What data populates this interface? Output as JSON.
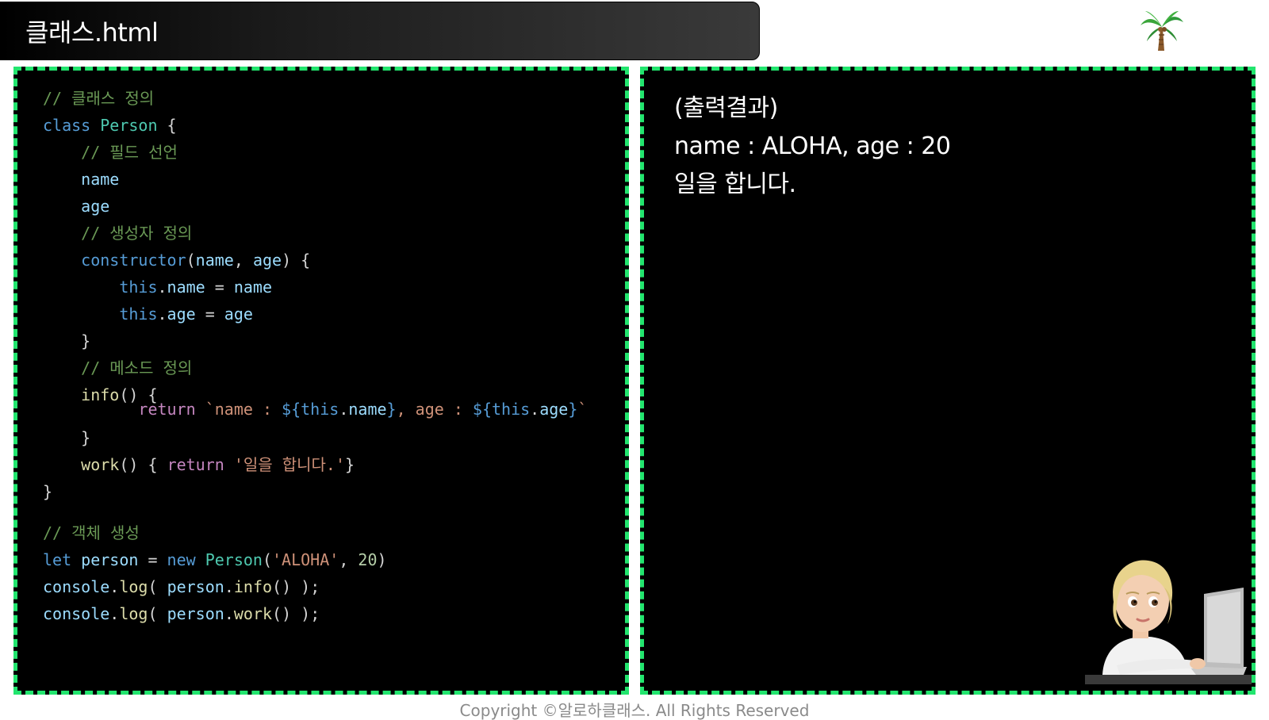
{
  "header": {
    "title": "클래스.html",
    "icon": "palm-tree-icon"
  },
  "code_panel": {
    "lines": [
      [
        {
          "t": "// 클래스 정의",
          "c": "comment"
        }
      ],
      [
        {
          "t": "class ",
          "c": "kw"
        },
        {
          "t": "Person",
          "c": "cls"
        },
        {
          "t": " {",
          "c": "plain"
        }
      ],
      [
        {
          "t": "    // 필드 선언",
          "c": "comment"
        }
      ],
      [
        {
          "t": "    ",
          "c": "plain"
        },
        {
          "t": "name",
          "c": "prop"
        }
      ],
      [
        {
          "t": "    ",
          "c": "plain"
        },
        {
          "t": "age",
          "c": "prop"
        }
      ],
      [
        {
          "t": "    // 생성자 정의",
          "c": "comment"
        }
      ],
      [
        {
          "t": "    ",
          "c": "plain"
        },
        {
          "t": "constructor",
          "c": "kw"
        },
        {
          "t": "(",
          "c": "plain"
        },
        {
          "t": "name",
          "c": "prop"
        },
        {
          "t": ", ",
          "c": "plain"
        },
        {
          "t": "age",
          "c": "prop"
        },
        {
          "t": ") {",
          "c": "plain"
        }
      ],
      [
        {
          "t": "        ",
          "c": "plain"
        },
        {
          "t": "this",
          "c": "kw"
        },
        {
          "t": ".",
          "c": "plain"
        },
        {
          "t": "name",
          "c": "prop"
        },
        {
          "t": " = ",
          "c": "plain"
        },
        {
          "t": "name",
          "c": "prop"
        }
      ],
      [
        {
          "t": "        ",
          "c": "plain"
        },
        {
          "t": "this",
          "c": "kw"
        },
        {
          "t": ".",
          "c": "plain"
        },
        {
          "t": "age",
          "c": "prop"
        },
        {
          "t": " = ",
          "c": "plain"
        },
        {
          "t": "age",
          "c": "prop"
        }
      ],
      [
        {
          "t": "    }",
          "c": "plain"
        }
      ],
      [
        {
          "t": "    // 메소드 정의",
          "c": "comment"
        }
      ],
      [
        {
          "t": "    ",
          "c": "plain"
        },
        {
          "t": "info",
          "c": "fn"
        },
        {
          "t": "() {",
          "c": "plain"
        }
      ],
      [
        {
          "t": "          ",
          "c": "plain"
        },
        {
          "t": "return",
          "c": "ctrl"
        },
        {
          "t": " `name : ",
          "c": "str"
        },
        {
          "t": "${",
          "c": "kw"
        },
        {
          "t": "this",
          "c": "kw"
        },
        {
          "t": ".",
          "c": "plain"
        },
        {
          "t": "name",
          "c": "prop"
        },
        {
          "t": "}",
          "c": "kw"
        },
        {
          "t": ", age : ",
          "c": "str"
        },
        {
          "t": "${",
          "c": "kw"
        },
        {
          "t": "this",
          "c": "kw"
        },
        {
          "t": ".",
          "c": "plain"
        },
        {
          "t": "age",
          "c": "prop"
        },
        {
          "t": "}",
          "c": "kw"
        },
        {
          "t": "`",
          "c": "str"
        }
      ],
      [
        {
          "t": "    }",
          "c": "plain"
        }
      ],
      [
        {
          "t": "    ",
          "c": "plain"
        },
        {
          "t": "work",
          "c": "fn"
        },
        {
          "t": "() { ",
          "c": "plain"
        },
        {
          "t": "return",
          "c": "ctrl"
        },
        {
          "t": " '일을 합니다.'",
          "c": "str"
        },
        {
          "t": "}",
          "c": "plain"
        }
      ],
      [
        {
          "t": "}",
          "c": "plain"
        }
      ],
      [
        {
          "t": "// 객체 생성",
          "c": "comment"
        }
      ],
      [
        {
          "t": "let ",
          "c": "kw"
        },
        {
          "t": "person",
          "c": "prop"
        },
        {
          "t": " = ",
          "c": "plain"
        },
        {
          "t": "new ",
          "c": "kw"
        },
        {
          "t": "Person",
          "c": "cls"
        },
        {
          "t": "(",
          "c": "plain"
        },
        {
          "t": "'ALOHA'",
          "c": "str"
        },
        {
          "t": ", ",
          "c": "plain"
        },
        {
          "t": "20",
          "c": "num"
        },
        {
          "t": ")",
          "c": "plain"
        }
      ],
      [
        {
          "t": "console",
          "c": "prop"
        },
        {
          "t": ".",
          "c": "plain"
        },
        {
          "t": "log",
          "c": "fn"
        },
        {
          "t": "( ",
          "c": "plain"
        },
        {
          "t": "person",
          "c": "prop"
        },
        {
          "t": ".",
          "c": "plain"
        },
        {
          "t": "info",
          "c": "fn"
        },
        {
          "t": "() );",
          "c": "plain"
        }
      ],
      [
        {
          "t": "console",
          "c": "prop"
        },
        {
          "t": ".",
          "c": "plain"
        },
        {
          "t": "log",
          "c": "fn"
        },
        {
          "t": "( ",
          "c": "plain"
        },
        {
          "t": "person",
          "c": "prop"
        },
        {
          "t": ".",
          "c": "plain"
        },
        {
          "t": "work",
          "c": "fn"
        },
        {
          "t": "() );",
          "c": "plain"
        }
      ]
    ]
  },
  "output_panel": {
    "heading": "(출력결과)",
    "lines": [
      "name : ALOHA, age : 20",
      "일을 합니다."
    ],
    "avatar_icon": "avatar-with-laptop-icon"
  },
  "footer": {
    "copyright": "Copyright ©알로하클래스. All Rights Reserved"
  },
  "colors": {
    "panel_border": "#22e56e",
    "panel_bg": "#000000",
    "comment": "#6a9955",
    "keyword": "#569cd6",
    "class": "#4ec9b0",
    "property": "#9cdcfe",
    "function": "#dcdcaa",
    "string": "#ce9178",
    "number": "#b5cea8",
    "control": "#c586c0"
  }
}
